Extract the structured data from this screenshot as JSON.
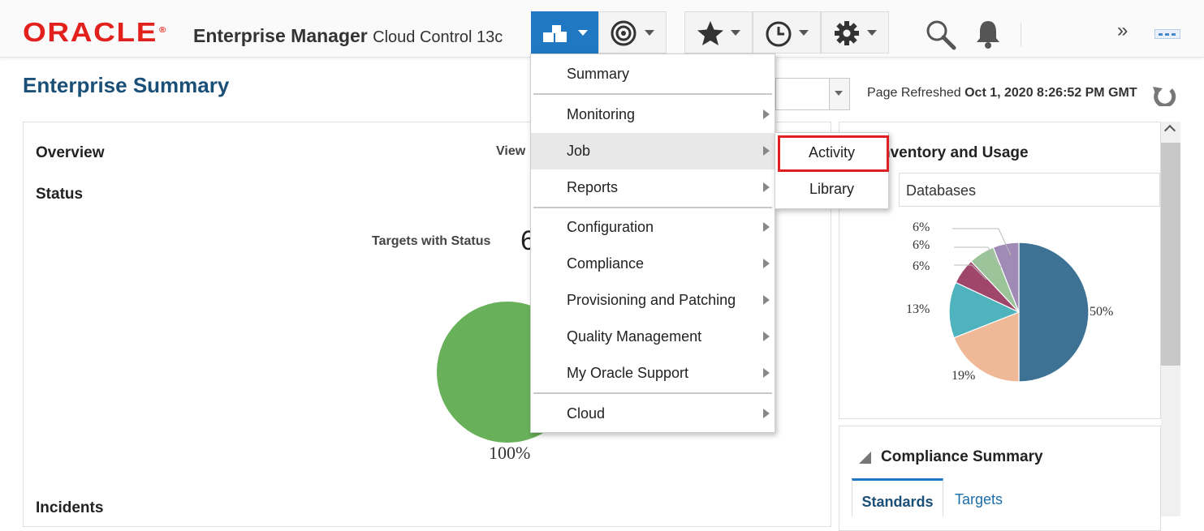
{
  "header": {
    "logo": "ORACLE",
    "logo_mark": "®",
    "product_name": "Enterprise Manager",
    "product_sub": "Cloud Control 13c"
  },
  "toolbar": {
    "icons": [
      "targets-icon",
      "target-icon",
      "favorites-icon",
      "history-icon",
      "setup-icon",
      "search-icon",
      "notification-icon",
      "more-icon",
      "menu-dots-icon"
    ],
    "more_label": "»"
  },
  "page": {
    "title": "Enterprise Summary",
    "refresh_label": "Page Refreshed",
    "refresh_time": "Oct 1, 2020 8:26:52 PM GMT"
  },
  "overview": {
    "title": "Overview",
    "view_label": "View",
    "status_title": "Status",
    "targets_label": "Targets with Status",
    "targets_count": "6",
    "status_pct": "100%",
    "incidents_title": "Incidents"
  },
  "inventory": {
    "title": "Inventory and Usage",
    "title_visible": "nventory and Usage",
    "selected": "Databases",
    "slices": [
      {
        "pct": 50,
        "label": "50%",
        "color": "#3e7295"
      },
      {
        "pct": 19,
        "label": "19%",
        "color": "#efb896"
      },
      {
        "pct": 13,
        "label": "13%",
        "color": "#4fb3be"
      },
      {
        "pct": 6,
        "label": "6%",
        "color": "#a0466b"
      },
      {
        "pct": 6,
        "label": "6%",
        "color": "#9cc49a"
      },
      {
        "pct": 6,
        "label": "6%",
        "color": "#9f8bb5"
      }
    ]
  },
  "compliance": {
    "title": "Compliance Summary",
    "tabs": [
      "Standards",
      "Targets"
    ]
  },
  "menu": {
    "items": [
      {
        "label": "Summary",
        "arrow": false
      },
      {
        "label": "Monitoring",
        "arrow": true
      },
      {
        "label": "Job",
        "arrow": true
      },
      {
        "label": "Reports",
        "arrow": true
      },
      {
        "label": "Configuration",
        "arrow": true
      },
      {
        "label": "Compliance",
        "arrow": true
      },
      {
        "label": "Provisioning and Patching",
        "arrow": true
      },
      {
        "label": "Quality Management",
        "arrow": true
      },
      {
        "label": "My Oracle Support",
        "arrow": true
      },
      {
        "label": "Cloud",
        "arrow": true
      }
    ],
    "selected": "Job"
  },
  "submenu": {
    "items": [
      "Activity",
      "Library"
    ],
    "highlighted": "Activity"
  },
  "colors": {
    "accent": "#1f78c1",
    "oracle_red": "#e2211c",
    "status_green": "#68b15a",
    "highlight_red": "#e02020"
  }
}
